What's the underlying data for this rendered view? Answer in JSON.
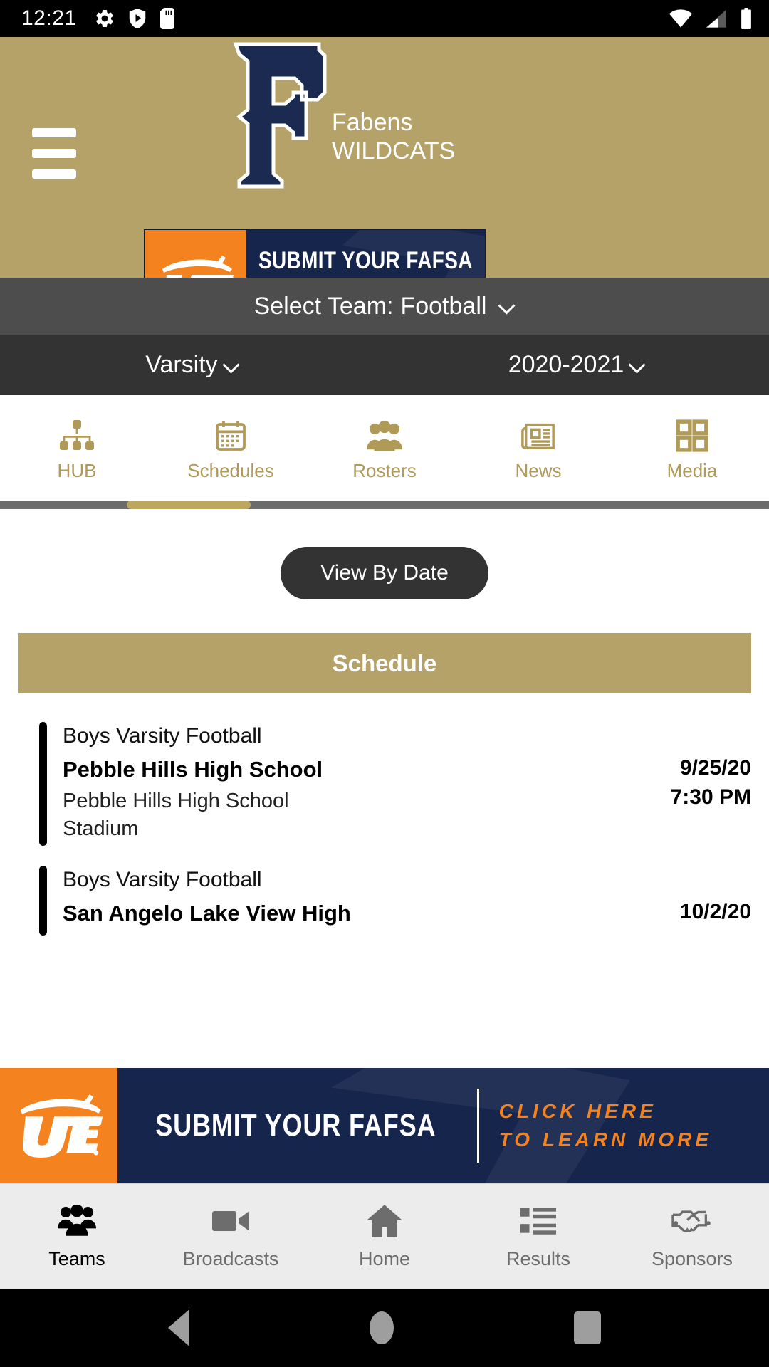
{
  "status_bar": {
    "time": "12:21",
    "left_icons": [
      "gear-icon",
      "shield-play-icon",
      "sd-card-icon"
    ],
    "right_icons": [
      "wifi-icon",
      "cellular-signal-icon",
      "battery-icon"
    ]
  },
  "header": {
    "menu_icon": "hamburger-menu-icon",
    "logo_letter": "F",
    "school_name": "Fabens",
    "mascot": "WILDCATS",
    "background_color": "#b5a269",
    "logo_color": "#1b2a50"
  },
  "ad_banner": {
    "sponsor": "UTEP",
    "title": "SUBMIT YOUR FAFSA",
    "subtitle_line1": "CLICK HERE",
    "subtitle_line2": "TO LEARN MORE",
    "accent_color": "#f4821f",
    "background_color": "#16254c"
  },
  "team_selector": {
    "label": "Select Team:",
    "value": "Football",
    "chevron": "chevron-down-icon"
  },
  "level_season": {
    "level": "Varsity",
    "season": "2020-2021"
  },
  "section_tabs": [
    {
      "label": "HUB",
      "icon": "sitemap-icon"
    },
    {
      "label": "Schedules",
      "icon": "calendar-icon",
      "active": true
    },
    {
      "label": "Rosters",
      "icon": "people-group-icon"
    },
    {
      "label": "News",
      "icon": "newspaper-icon"
    },
    {
      "label": "Media",
      "icon": "grid-squares-icon"
    }
  ],
  "content": {
    "view_by_date_label": "View By Date",
    "schedule_heading": "Schedule",
    "events": [
      {
        "sport": "Boys Varsity Football",
        "opponent": "Pebble Hills High School",
        "venue": "Pebble Hills High School Stadium",
        "date": "9/25/20",
        "time": "7:30 PM"
      },
      {
        "sport": "Boys Varsity Football",
        "opponent": "San Angelo Lake View High",
        "venue": "",
        "date": "10/2/20",
        "time": ""
      }
    ]
  },
  "bottom_nav": [
    {
      "label": "Teams",
      "icon": "people-group-icon",
      "active": true
    },
    {
      "label": "Broadcasts",
      "icon": "video-camera-icon",
      "active": false
    },
    {
      "label": "Home",
      "icon": "house-icon",
      "active": false
    },
    {
      "label": "Results",
      "icon": "list-icon",
      "active": false
    },
    {
      "label": "Sponsors",
      "icon": "handshake-icon",
      "active": false
    }
  ],
  "android_nav": {
    "back": "back-triangle-icon",
    "home": "home-circle-icon",
    "recents": "recents-square-icon"
  }
}
